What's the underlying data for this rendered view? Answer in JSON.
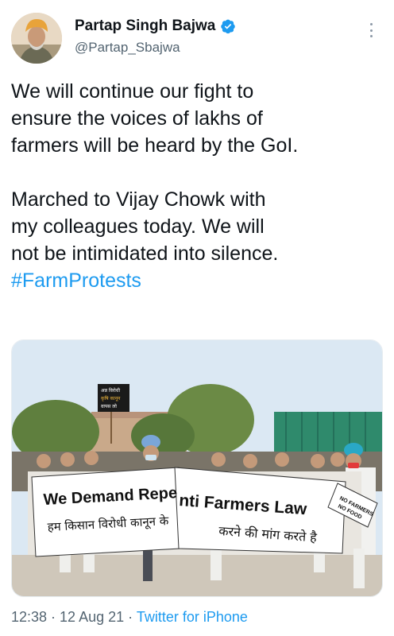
{
  "tweet": {
    "display_name": "Partap Singh Bajwa",
    "handle": "@Partap_Sbajwa",
    "paragraph1": [
      "We will continue our fight to",
      "ensure the voices of lakhs of",
      "farmers will be heard by the GoI."
    ],
    "paragraph2": [
      "Marched to Vijay Chowk with",
      "my colleagues today. We will",
      "not be intimidated into silence."
    ],
    "hashtag": "#FarmProtests",
    "time": "12:38",
    "separator1": " · ",
    "date": "12 Aug 21",
    "separator2": " · ",
    "source": "Twitter for iPhone"
  },
  "photo": {
    "banner_english": "We Demand Repeal of Anti Farmers Law",
    "banner_english_visible_left": "We Demand Repe",
    "banner_english_visible_right": "nti Farmers Law",
    "banner_hindi_left": "हम किसान विरोधी कानून के",
    "banner_hindi_right": "करने की मांग करते है",
    "placard_right": [
      "NO FARMERS",
      "NO FOOD"
    ],
    "placard_top": [
      "अन्न विरोधी",
      "कृषि कानून",
      "वापस लो"
    ]
  },
  "colors": {
    "link": "#1d9bf0",
    "verified": "#1d9bf0",
    "secondary_text": "#536471"
  },
  "icons": {
    "verified": "verified-badge-icon",
    "more": "more-options-icon"
  }
}
